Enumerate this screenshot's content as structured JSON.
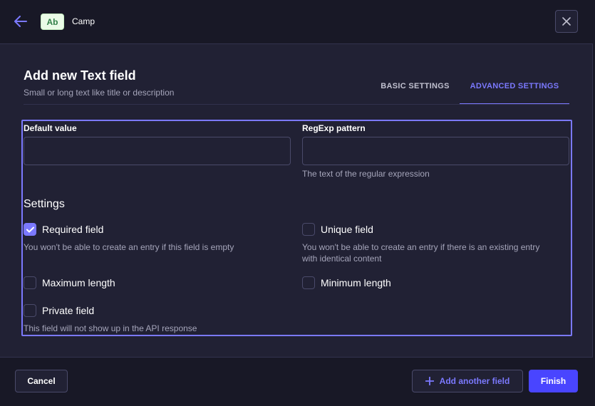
{
  "header": {
    "type_badge": "Ab",
    "breadcrumb": "Camp"
  },
  "dialog": {
    "title": "Add new Text field",
    "subtitle": "Small or long text like title or description"
  },
  "tabs": [
    {
      "label": "BASIC SETTINGS",
      "active": false
    },
    {
      "label": "ADVANCED SETTINGS",
      "active": true
    }
  ],
  "fields": {
    "default_value": {
      "label": "Default value",
      "value": ""
    },
    "regexp": {
      "label": "RegExp pattern",
      "value": "",
      "hint": "The text of the regular expression"
    }
  },
  "settings": {
    "title": "Settings",
    "required": {
      "label": "Required field",
      "checked": true,
      "hint": "You won't be able to create an entry if this field is empty"
    },
    "unique": {
      "label": "Unique field",
      "checked": false,
      "hint_line1": "You won't be able to create an entry if there is an existing entry",
      "hint_line2": "with identical content"
    },
    "max_length": {
      "label": "Maximum length",
      "checked": false
    },
    "min_length": {
      "label": "Minimum length",
      "checked": false
    },
    "private": {
      "label": "Private field",
      "checked": false,
      "hint": "This field will not show up in the API response"
    }
  },
  "footer": {
    "cancel": "Cancel",
    "add_another": "Add another field",
    "finish": "Finish"
  },
  "colors": {
    "accent": "#7b79ff",
    "primary_button": "#4945ff",
    "background": "#212134",
    "header_background": "#181826",
    "badge_background": "#eafbe7",
    "badge_text": "#328048"
  },
  "icons": {
    "back": "arrow-left-icon",
    "close": "close-icon",
    "check": "check-icon",
    "plus": "plus-icon"
  }
}
